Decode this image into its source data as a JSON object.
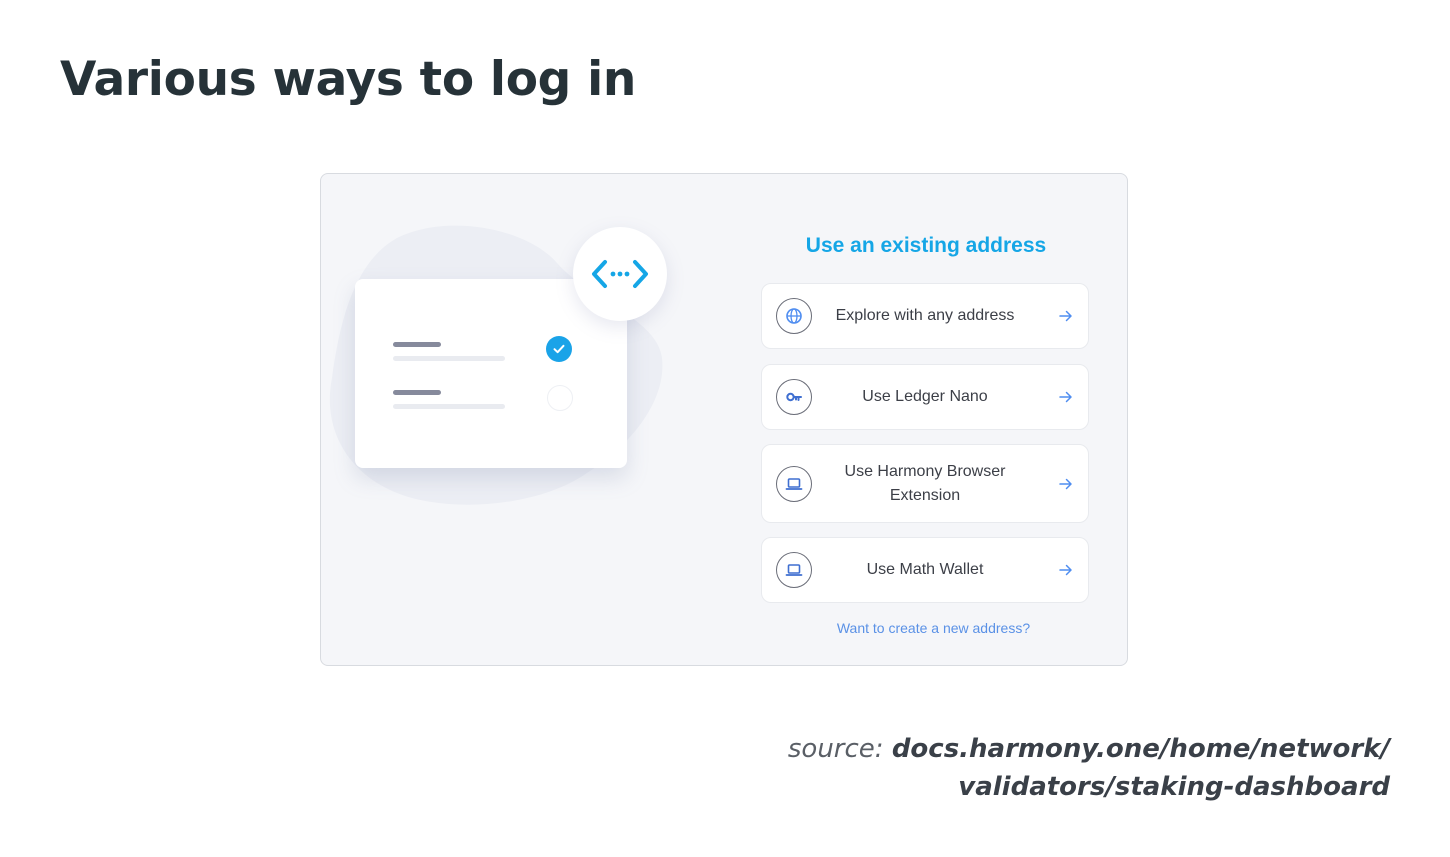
{
  "slide": {
    "title": "Various ways to log in",
    "source_prefix": "source: ",
    "source_url_line1": "docs.harmony.one/home/network/",
    "source_url_line2": "validators/staking-dashboard"
  },
  "login_panel": {
    "heading": "Use an existing address",
    "options": [
      {
        "label": "Explore with any address",
        "icon": "globe-icon"
      },
      {
        "label": "Use Ledger Nano",
        "icon": "key-icon"
      },
      {
        "label": "Use Harmony Browser Extension",
        "icon": "laptop-icon"
      },
      {
        "label": "Use Math Wallet",
        "icon": "laptop-icon"
      }
    ],
    "create_link": "Want to create a new address?"
  },
  "illustration": {
    "logo_icon": "harmony-code-arrows-icon",
    "checked_icon": "checkmark-icon"
  },
  "colors": {
    "accent": "#15a6e6",
    "link": "#5a91e6",
    "title": "#263238",
    "panel_bg": "#f5f6f9"
  }
}
